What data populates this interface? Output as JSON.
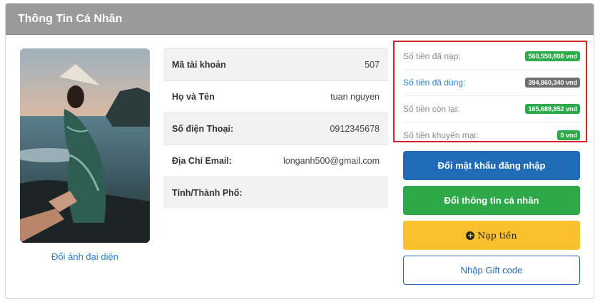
{
  "panel": {
    "title": "Thông Tin Cá Nhân"
  },
  "avatar": {
    "change_label": "Đổi ảnh đại diện"
  },
  "info": {
    "rows": [
      {
        "key": "Mã tài khoản",
        "value": "507"
      },
      {
        "key": "Họ và Tên",
        "value": "tuan nguyen"
      },
      {
        "key": "Số điện Thoại:",
        "value": "0912345678"
      },
      {
        "key": "Địa Chỉ Email:",
        "value": "longanh500@gmail.com"
      },
      {
        "key": "Tỉnh/Thành Phố:",
        "value": ""
      }
    ]
  },
  "balance": {
    "rows": [
      {
        "label": "Số tiền đã nạp:",
        "amount": "560,550,808 vnd",
        "color": "#2eaa4a"
      },
      {
        "label": "Số tiền đã dùng:",
        "amount": "394,860,340 vnd",
        "color": "#6f6f6f"
      },
      {
        "label": "Số tiền còn lại:",
        "amount": "165,689,852 vnd",
        "color": "#2eaa4a"
      },
      {
        "label": "Số tiền khuyến mại:",
        "amount": "0 vnd",
        "color": "#2eaa4a"
      }
    ]
  },
  "buttons": {
    "change_password": "Đổi mật khẩu đăng nhập",
    "change_info": "Đổi thông tin cá nhân",
    "topup": "Nạp tiền",
    "giftcode": "Nhập Gift code"
  },
  "icons": {
    "topup": "plus-circle-icon"
  }
}
